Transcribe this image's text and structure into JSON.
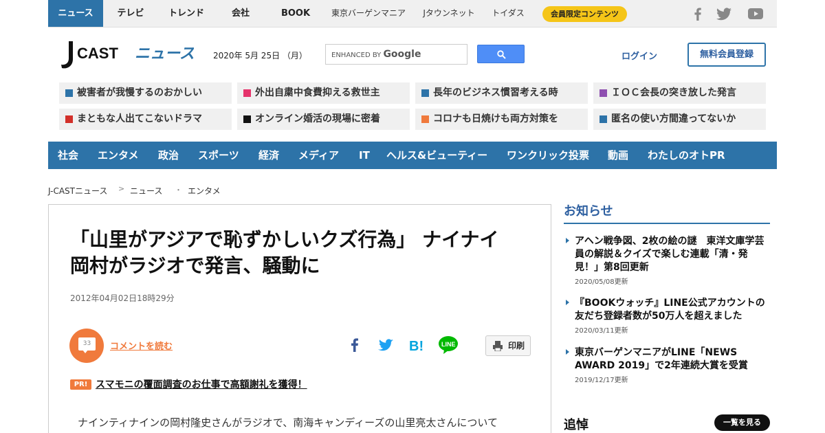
{
  "topbar": {
    "items": [
      {
        "label": "ニュース"
      },
      {
        "label": "テレビ"
      },
      {
        "label": "トレンド"
      },
      {
        "label": "会社"
      },
      {
        "label": "BOOK"
      },
      {
        "label": "東京バーゲンマニア"
      },
      {
        "label": "Jタウンネット"
      },
      {
        "label": "トイダス"
      }
    ],
    "member_label": "会員限定コンテンツ",
    "social_icons": [
      "facebook-icon",
      "twitter-icon",
      "youtube-icon"
    ]
  },
  "header": {
    "logo_text": "CAST ニュース",
    "logo_j": "J",
    "logo_cast": "CAST",
    "logo_news": "ニュース",
    "date": "2020年 5月 25日 （月）",
    "search_enhanced": "ENHANCED BY",
    "search_google": "Google",
    "login": "ログイン",
    "register": "無料会員登録"
  },
  "topics": [
    {
      "label": "被害者が我慢するのおかしい",
      "color": "#2d73a8"
    },
    {
      "label": "外出自粛中食費抑える救世主",
      "color": "#e5336b"
    },
    {
      "label": "長年のビジネス慣習考える時",
      "color": "#2d73a8"
    },
    {
      "label": "ＩＯＣ会長の突き放した発言",
      "color": "#8e4fb0"
    },
    {
      "label": "まともな人出てこないドラマ",
      "color": "#d2302a"
    },
    {
      "label": "オンライン婚活の現場に密着",
      "color": "#111111"
    },
    {
      "label": "コロナも日焼けも両方対策を",
      "color": "#f07a3c"
    },
    {
      "label": "匿名の使い方間違ってないか",
      "color": "#2d73a8"
    }
  ],
  "categories": [
    {
      "label": "社会"
    },
    {
      "label": "エンタメ"
    },
    {
      "label": "政治"
    },
    {
      "label": "スポーツ"
    },
    {
      "label": "経済"
    },
    {
      "label": "メディア"
    },
    {
      "label": "IT"
    },
    {
      "label": "ヘルス&ビューティー"
    },
    {
      "label": "ワンクリック投票"
    },
    {
      "label": "動画"
    },
    {
      "label": "わたしのオトPR"
    }
  ],
  "breadcrumb": [
    "J-CASTニュース",
    "ニュース",
    "エンタメ"
  ],
  "breadcrumb_seps": [
    ">",
    "・"
  ],
  "article": {
    "headline_line1": "「山里がアジアで恥ずかしいクズ行為」 ナイナイ",
    "headline_line2": "岡村がラジオで発言、騒動に",
    "date": "2012年04月02日18時29分",
    "comment_count": "33",
    "comment_link": "コメントを読む",
    "share_icons": [
      "facebook-share-icon",
      "twitter-share-icon",
      "hatena-bookmark-icon",
      "line-share-icon"
    ],
    "print_label": "印刷",
    "pr_badge": "PR!",
    "pr_link": "スマモニの覆面調査のお仕事で高額謝礼を獲得！",
    "body_first_line": "ナインティナインの岡村隆史さんがラジオで、南海キャンディーズの山里亮太さんについて"
  },
  "sidebar": {
    "title": "お知らせ",
    "news": [
      {
        "title": "アヘン戦争図、2枚の絵の謎　東洋文庫学芸員の解説＆クイズで楽しむ連載「清・発見！」第8回更新",
        "date": "2020/05/08更新"
      },
      {
        "title": "『BOOKウォッチ』LINE公式アカウントの友だち登録者数が50万人を超えました",
        "date": "2020/03/11更新"
      },
      {
        "title": "東京バーゲンマニアがLINE「NEWS AWARD 2019」で2年連続大賞を受賞",
        "date": "2019/12/17更新"
      }
    ],
    "tsuito_title": "追悼",
    "list_button": "一覧を見る"
  },
  "colors": {
    "brand_blue": "#2d73a8",
    "accent_orange": "#f07a3c",
    "member_yellow": "#f5c518"
  }
}
